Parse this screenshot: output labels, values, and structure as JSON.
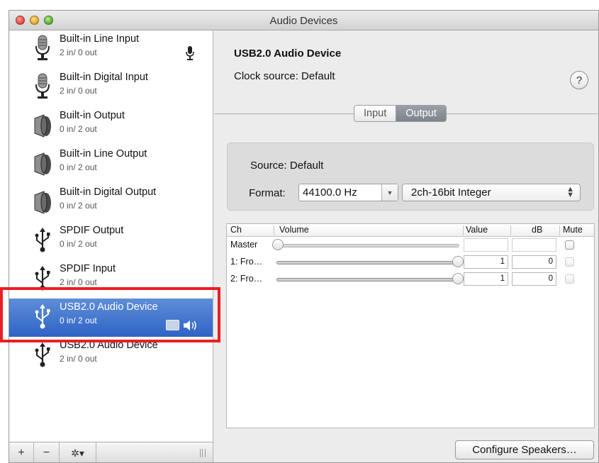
{
  "window": {
    "title": "Audio Devices"
  },
  "devices": [
    {
      "name": "Built-in Line Input",
      "io": "2 in/ 0 out",
      "icon": "microphone-icon",
      "indicator": "microphone"
    },
    {
      "name": "Built-in Digital Input",
      "io": "2 in/ 0 out",
      "icon": "microphone-icon"
    },
    {
      "name": "Built-in Output",
      "io": "0 in/ 2 out",
      "icon": "speaker-icon"
    },
    {
      "name": "Built-in Line Output",
      "io": "0 in/ 2 out",
      "icon": "speaker-icon"
    },
    {
      "name": "Built-in Digital Output",
      "io": "0 in/ 2 out",
      "icon": "speaker-icon"
    },
    {
      "name": "SPDIF Output",
      "io": "0 in/ 2 out",
      "icon": "usb-icon"
    },
    {
      "name": "SPDIF Input",
      "io": "2 in/ 0 out",
      "icon": "usb-icon"
    },
    {
      "name": "USB2.0 Audio Device",
      "io": "0 in/ 2 out",
      "icon": "usb-icon",
      "selected": true,
      "indicator": "finder-speaker"
    },
    {
      "name": "USB2.0 Audio Device",
      "io": "2 in/ 0 out",
      "icon": "usb-icon"
    }
  ],
  "sidebar_toolbar": {
    "add": "+",
    "remove": "−",
    "gear": "✲▾"
  },
  "detail": {
    "device_name": "USB2.0 Audio Device",
    "clock_source": "Clock source: Default",
    "help": "?",
    "tabs": [
      {
        "label": "Input",
        "active": false
      },
      {
        "label": "Output",
        "active": true
      }
    ],
    "source": "Source:  Default",
    "format_label": "Format:",
    "sample_rate": "44100.0 Hz",
    "bit_format": "2ch-16bit Integer",
    "table": {
      "headers": {
        "ch": "Ch",
        "volume": "Volume",
        "value": "Value",
        "db": "dB",
        "mute": "Mute"
      },
      "rows": [
        {
          "ch": "Master",
          "value": "",
          "db": "",
          "volume_level": 0,
          "enabled": false
        },
        {
          "ch": "1: Fro…",
          "value": "1",
          "db": "0",
          "volume_level": 1,
          "enabled": true
        },
        {
          "ch": "2: Fro…",
          "value": "1",
          "db": "0",
          "volume_level": 1,
          "enabled": true
        }
      ]
    },
    "configure_button": "Configure Speakers…"
  },
  "colors": {
    "selection": "#3b6fcf",
    "highlight_box": "#ea1f25",
    "segment_active": "#858b92"
  }
}
